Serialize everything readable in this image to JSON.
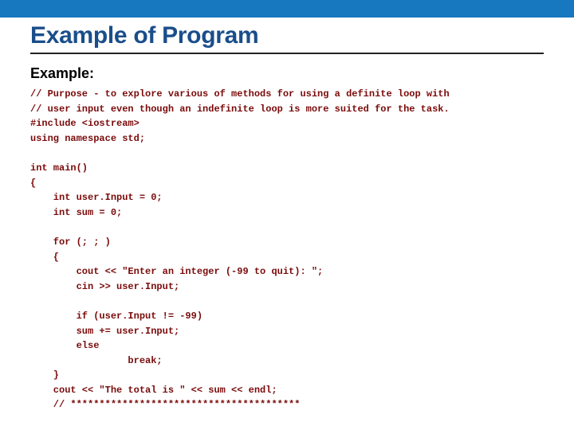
{
  "header": {
    "title": "Example of Program",
    "subtitle": "Example:"
  },
  "code": {
    "lines": [
      "// Purpose - to explore various of methods for using a definite loop with",
      "// user input even though an indefinite loop is more suited for the task.",
      "#include <iostream>",
      "using namespace std;",
      "",
      "int main()",
      "{",
      "    int user.Input = 0;",
      "    int sum = 0;",
      "",
      "    for (; ; )",
      "    {",
      "        cout << \"Enter an integer (-99 to quit): \";",
      "        cin >> user.Input;",
      "",
      "        if (user.Input != -99)",
      "        sum += user.Input;",
      "        else",
      "                 break;",
      "    }",
      "    cout << \"The total is \" << sum << endl;",
      "    // ****************************************"
    ]
  }
}
